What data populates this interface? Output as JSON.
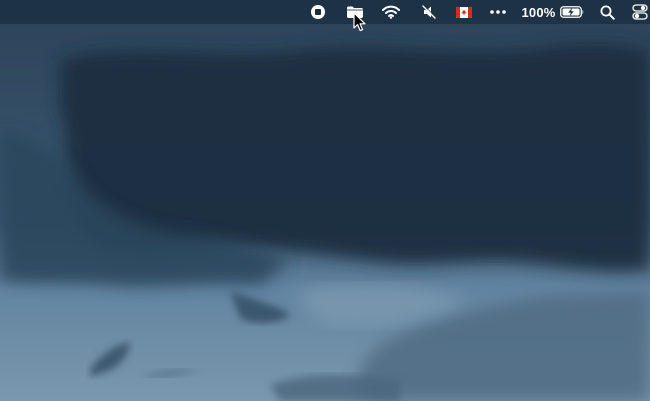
{
  "menubar": {
    "status_items": [
      {
        "icon": "screen-recording-stop-icon"
      },
      {
        "icon": "folder-icon"
      },
      {
        "icon": "wifi-icon"
      },
      {
        "icon": "speaker-muted-icon"
      },
      {
        "icon": "canadian-flag-input-source-icon"
      },
      {
        "icon": "more-ellipsis-icon"
      },
      {
        "icon": "battery-charging-icon"
      },
      {
        "icon": "spotlight-search-icon"
      },
      {
        "icon": "control-center-icon"
      }
    ],
    "battery_percent": "100%"
  },
  "colors": {
    "menubar_bg": "#142434",
    "sky_dark": "#1f3346",
    "sky_light": "#7695ac",
    "flag_red": "#d52b1e",
    "battery_green": "#ffffff"
  }
}
